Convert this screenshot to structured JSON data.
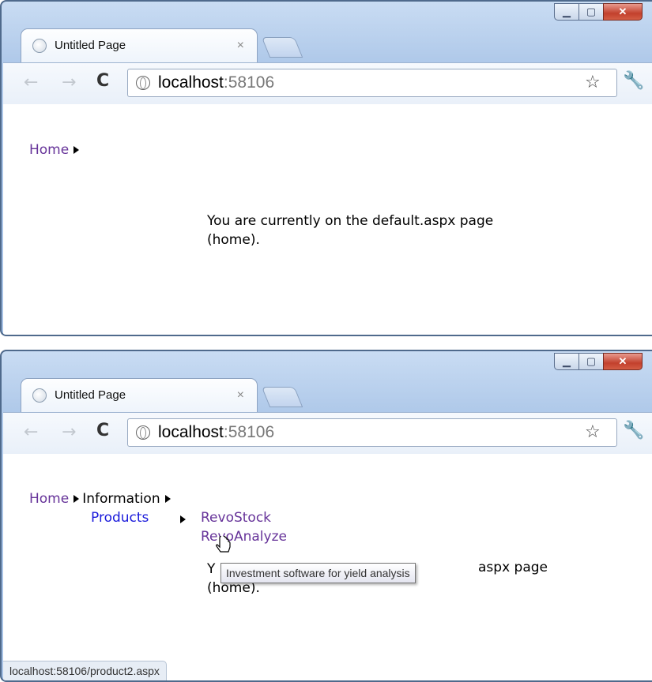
{
  "window1": {
    "tab_title": "Untitled Page",
    "tab_close": "×",
    "url_host": "localhost",
    "url_port": ":58106",
    "breadcrumb_home": "Home",
    "body_line1": "You are currently on the default.aspx page",
    "body_line2": "(home)."
  },
  "window2": {
    "tab_title": "Untitled Page",
    "tab_close": "×",
    "url_host": "localhost",
    "url_port": ":58106",
    "breadcrumb_home": "Home",
    "breadcrumb_information": "Information",
    "menu_products": "Products",
    "submenu_item1": "RevoStock",
    "submenu_item2": "RevoAnalyze",
    "body_line1_visible_start": "Y",
    "body_line1_visible_end": "aspx page",
    "body_line2": "(home).",
    "tooltip": "Investment software for yield analysis",
    "status_url": "localhost:58106/product2.aspx"
  },
  "icons": {
    "back": "back-arrow-icon",
    "forward": "forward-arrow-icon",
    "reload": "reload-icon",
    "globe": "globe-icon",
    "star": "bookmark-star-icon",
    "wrench": "wrench-menu-icon",
    "minimize": "minimize-icon",
    "maximize": "maximize-icon",
    "close": "close-icon"
  },
  "colors": {
    "visited_link": "#663399",
    "menu_link": "#1a1adb"
  }
}
